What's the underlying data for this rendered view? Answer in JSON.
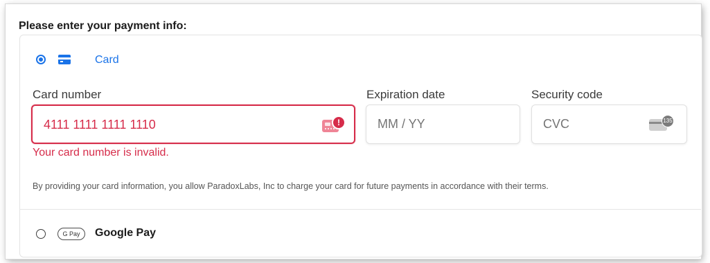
{
  "heading": "Please enter your payment info:",
  "methods": {
    "card": {
      "label": "Card",
      "selected": true,
      "icon": "card-icon"
    },
    "google_pay": {
      "label": "Google Pay",
      "selected": false,
      "badge": "G Pay",
      "icon": "google-pay-badge"
    }
  },
  "fields": {
    "card_number": {
      "label": "Card number",
      "value": "4111 1111 1111 1110",
      "placeholder": "",
      "error": "Your card number is invalid."
    },
    "expiration": {
      "label": "Expiration date",
      "value": "",
      "placeholder": "MM / YY"
    },
    "security_code": {
      "label": "Security code",
      "value": "",
      "placeholder": "CVC",
      "icon_badge": "135"
    }
  },
  "terms": "By providing your card information, you allow ParadoxLabs, Inc to charge your card for future payments in accordance with their terms.",
  "colors": {
    "accent": "#1a73e8",
    "error": "#d62c4a"
  }
}
